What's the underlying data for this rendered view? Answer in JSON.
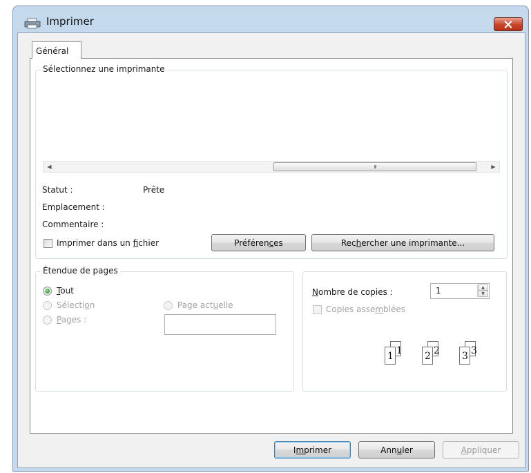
{
  "window": {
    "title": "Imprimer",
    "close_icon": "close-icon"
  },
  "tabs": [
    {
      "label": "Général",
      "selected": true
    }
  ],
  "printer_group": {
    "label": "Sélectionnez une imprimante",
    "scroll_thumb_glyph": "III",
    "status_label": "Statut :",
    "status_value": "Prête",
    "location_label": "Emplacement :",
    "location_value": "",
    "comment_label": "Commentaire :",
    "comment_value": "",
    "print_to_file": {
      "label_before": "Imprimer dans un ",
      "label_ul": "f",
      "label_after": "ichier",
      "checked": false
    },
    "preferences_button": {
      "before": "Préféren",
      "ul": "c",
      "after": "es"
    },
    "find_printer_button": {
      "before": "Rec",
      "ul": "h",
      "after": "ercher une imprimante..."
    }
  },
  "page_range_group": {
    "label": "Étendue de pages",
    "all": {
      "ul": "T",
      "after": "out",
      "selected": true
    },
    "selection": {
      "before": "Sélecti",
      "ul": "o",
      "after": "n",
      "enabled": false
    },
    "current_page": {
      "before": "Page act",
      "ul": "u",
      "after": "elle",
      "enabled": false
    },
    "pages": {
      "ul": "P",
      "after": "ages :",
      "enabled": false
    },
    "pages_value": ""
  },
  "copies_group": {
    "count_label": {
      "ul": "N",
      "after": "ombre de copies :"
    },
    "count_value": "1",
    "collate": {
      "before": "Copies asse",
      "ul": "m",
      "after": "blées",
      "checked": false,
      "enabled": false
    },
    "collate_pages": [
      "1",
      "2",
      "3"
    ]
  },
  "buttons": {
    "print": {
      "before": "I",
      "ul": "m",
      "after": "primer"
    },
    "cancel": {
      "before": "Ann",
      "ul": "u",
      "after": "ler"
    },
    "apply": {
      "ul": "A",
      "after": "ppliquer"
    }
  },
  "colors": {
    "frame": "#c5d9ec",
    "close": "#c7442a",
    "radio_on": "#1f7d1f"
  }
}
